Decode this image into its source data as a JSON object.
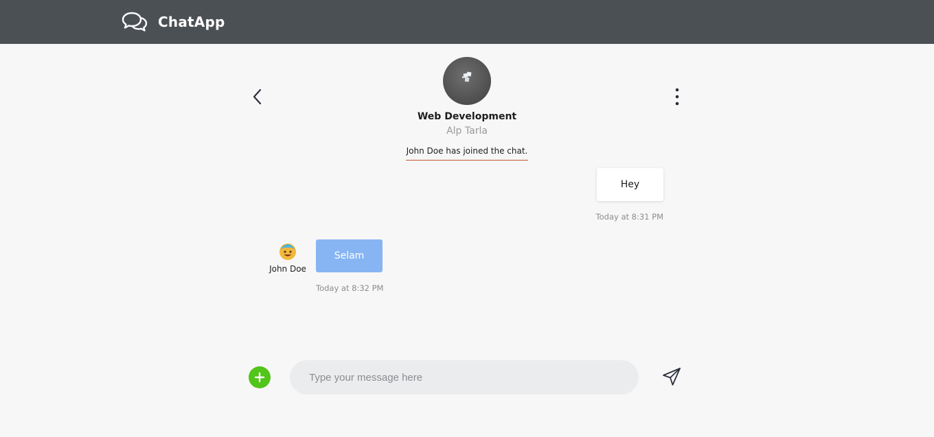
{
  "navbar": {
    "brand_icon": "chat-bubbles-icon",
    "brand_name": "ChatApp",
    "background": "#4b5055"
  },
  "chat_header": {
    "back_icon": "chevron-left-icon",
    "more_icon": "vertical-dots-icon",
    "room_title": "Web Development",
    "room_owner": "Alp Tarla"
  },
  "system_message": "John Doe has joined the chat.",
  "messages": [
    {
      "direction": "outgoing",
      "text": "Hey",
      "timestamp": "Today at 8:31 PM"
    },
    {
      "direction": "incoming",
      "sender": "John Doe",
      "avatar_icon": "emoji-avatar-icon",
      "text": "Selam",
      "timestamp": "Today at 8:32 PM"
    }
  ],
  "composer": {
    "add_icon": "plus-icon",
    "placeholder": "Type your message here",
    "value": "",
    "send_icon": "paper-plane-icon",
    "accent": "#52c41a"
  }
}
